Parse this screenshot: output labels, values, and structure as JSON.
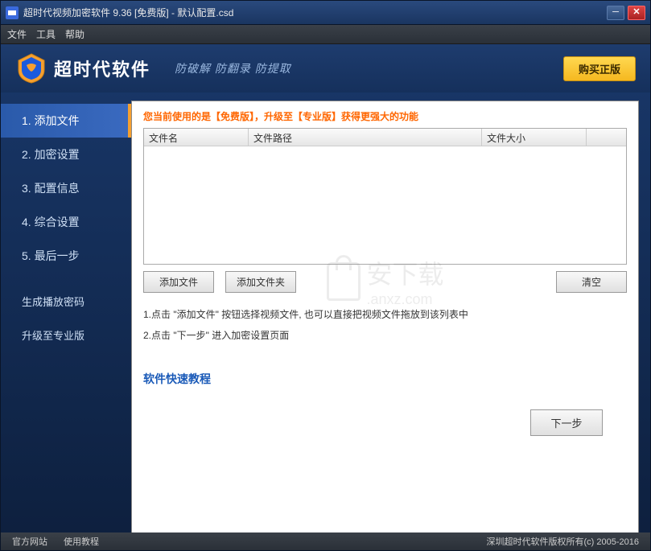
{
  "titlebar": {
    "title": "超时代视频加密软件 9.36 [免费版] - 默认配置.csd"
  },
  "menubar": {
    "items": [
      "文件",
      "工具",
      "帮助"
    ]
  },
  "header": {
    "brand": "超时代软件",
    "slogan": "防破解 防翻录 防提取",
    "buy_label": "购买正版"
  },
  "sidebar": {
    "steps": [
      "1. 添加文件",
      "2. 加密设置",
      "3. 配置信息",
      "4. 综合设置",
      "5. 最后一步"
    ],
    "extras": [
      "生成播放密码",
      "升级至专业版"
    ]
  },
  "content": {
    "notice": "您当前使用的是【免费版】，升级至【专业版】获得更强大的功能",
    "columns": [
      "文件名",
      "文件路径",
      "文件大小",
      ""
    ],
    "watermark_text": "安下载",
    "watermark_url": ".anxz.com",
    "buttons": {
      "add_file": "添加文件",
      "add_folder": "添加文件夹",
      "clear": "清空"
    },
    "instructions": [
      "1.点击 \"添加文件\" 按钮选择视频文件, 也可以直接把视频文件拖放到该列表中",
      "2.点击 \"下一步\" 进入加密设置页面"
    ],
    "tutorial": "软件快速教程",
    "next": "下一步"
  },
  "footer": {
    "links": [
      "官方网站",
      "使用教程"
    ],
    "copyright": "深圳超时代软件版权所有(c) 2005-2016"
  }
}
